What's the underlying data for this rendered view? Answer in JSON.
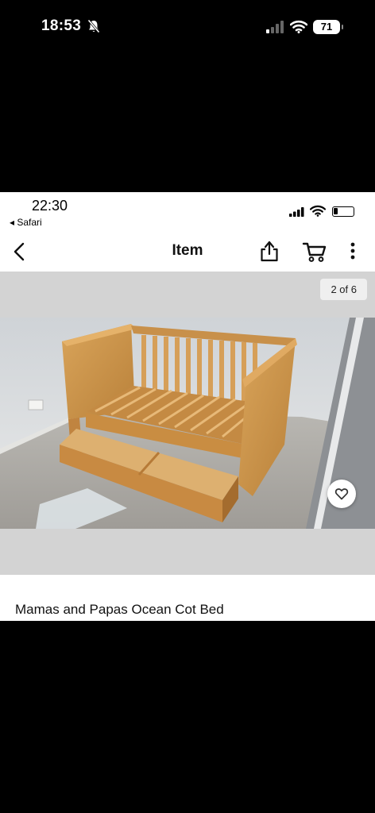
{
  "outer_status": {
    "time": "18:53",
    "battery": "71"
  },
  "inner_status": {
    "time": "22:30",
    "back_app": "◂ Safari"
  },
  "nav": {
    "title": "Item"
  },
  "gallery": {
    "counter": "2 of 6"
  },
  "item": {
    "title": "Mamas and Papas Ocean Cot Bed"
  },
  "icons": {
    "back": "chevron-left-icon",
    "share": "share-icon",
    "cart": "cart-icon",
    "more": "more-vertical-icon",
    "favorite": "heart-icon"
  }
}
